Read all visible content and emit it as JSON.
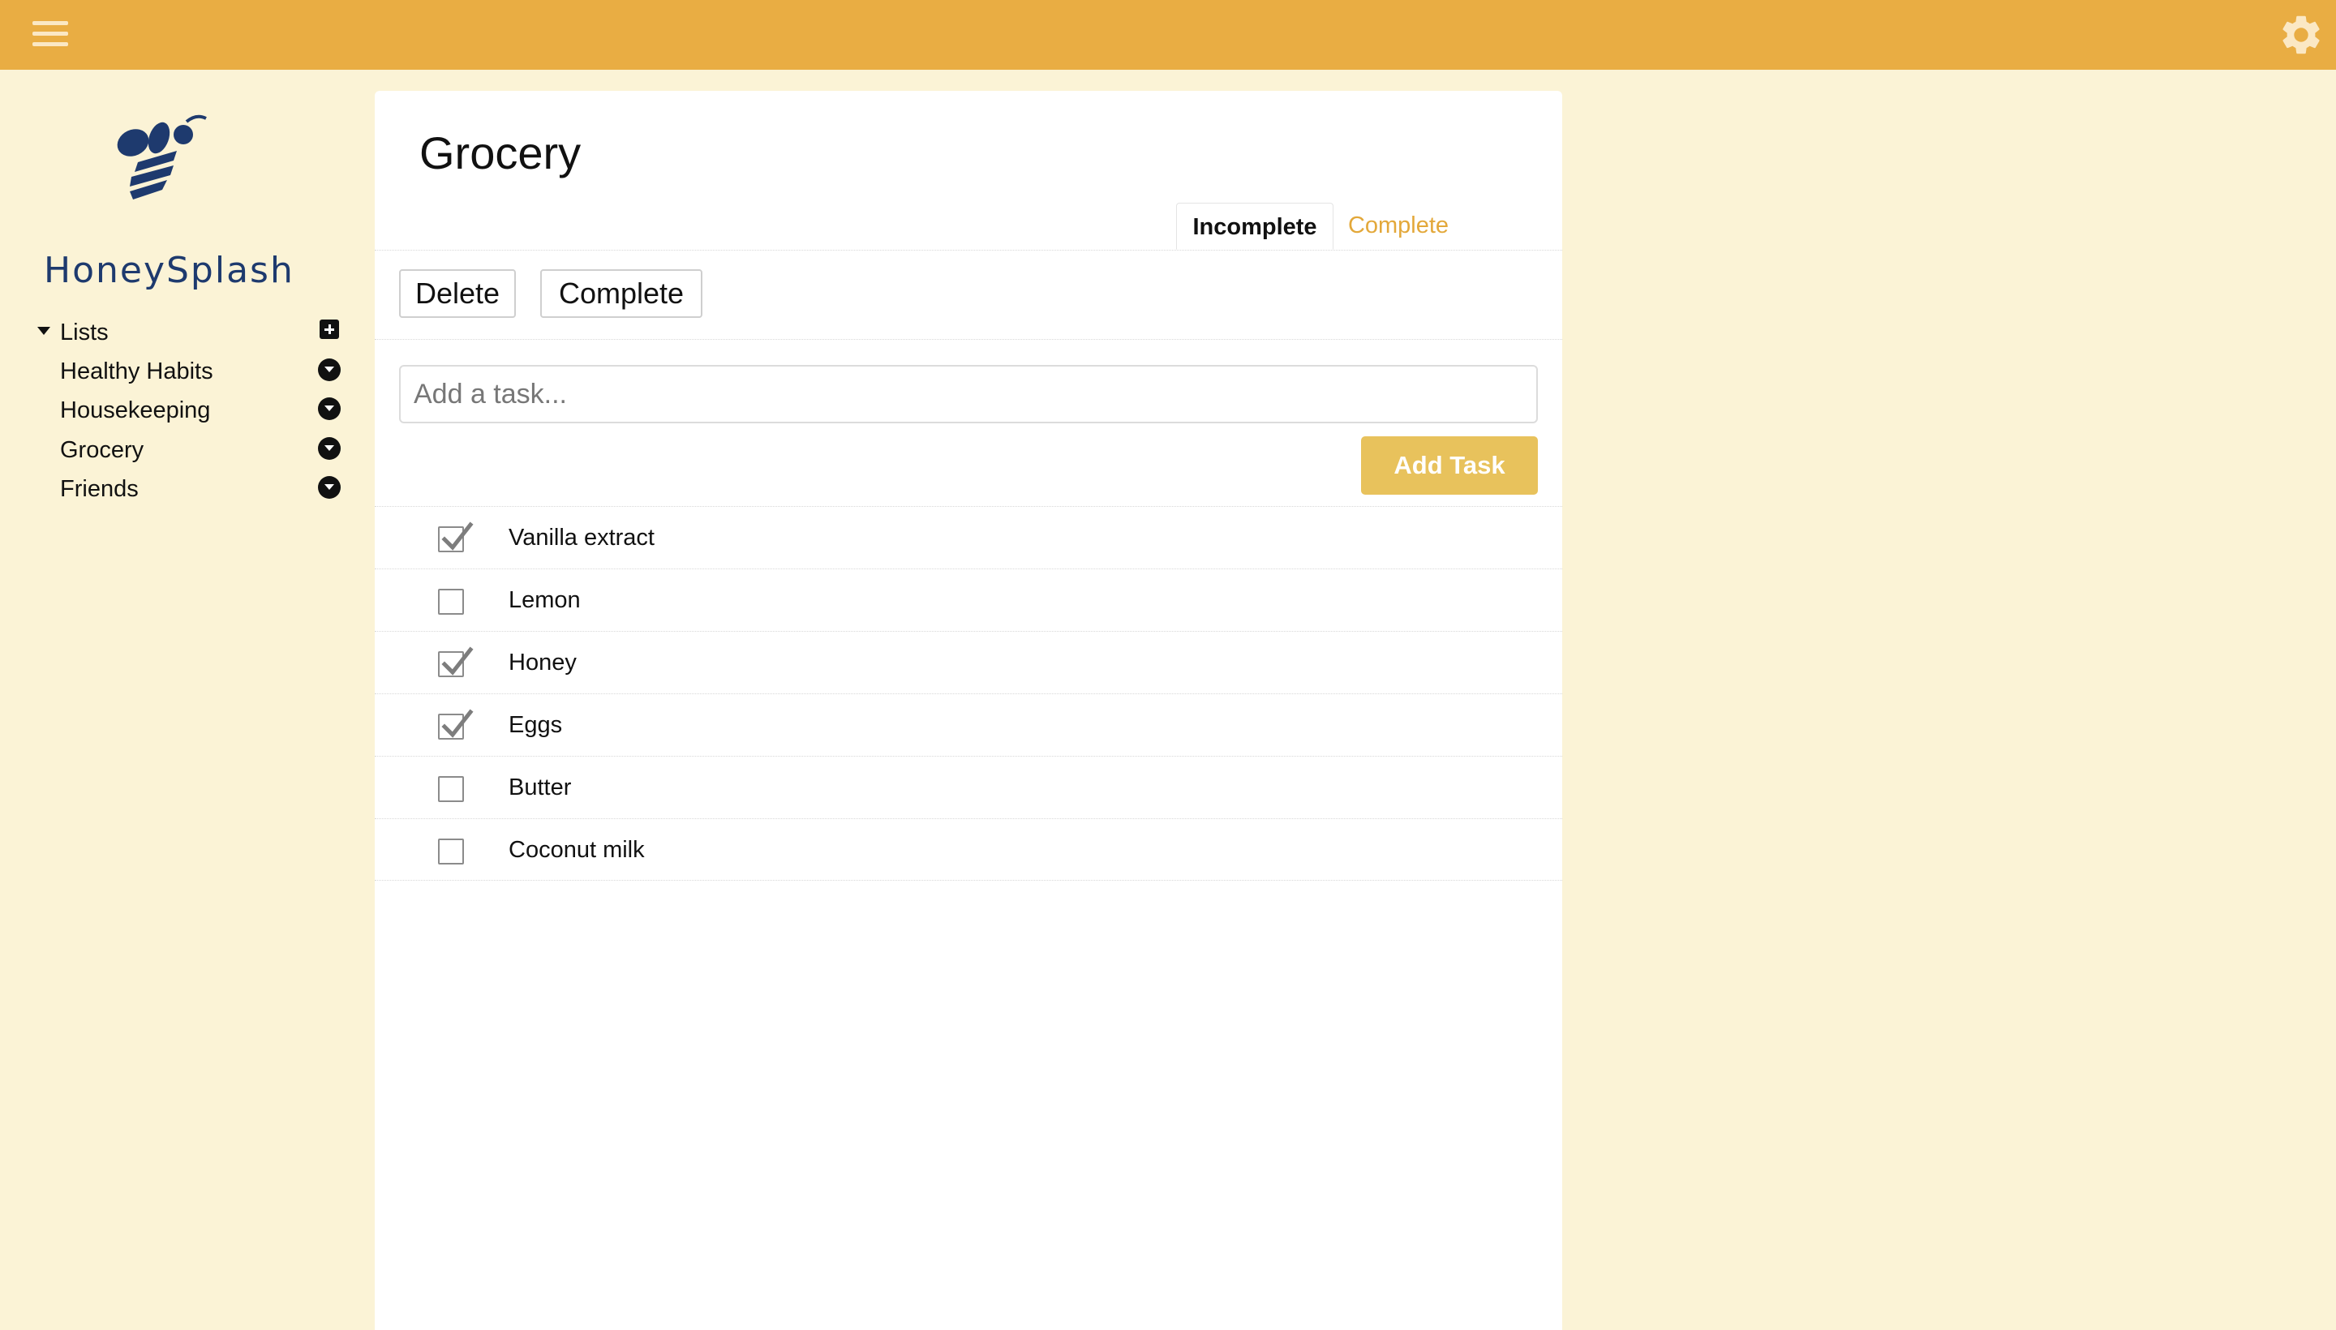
{
  "app": {
    "brand": "HoneySplash"
  },
  "colors": {
    "topbar": "#e9ad43",
    "background": "#fbf3d6",
    "accent": "#e3a83a",
    "add_button": "#e8c25c",
    "brand_text": "#1e3a6e"
  },
  "topbar": {
    "menu_icon": "hamburger-menu-icon",
    "settings_icon": "gear-icon"
  },
  "sidebar": {
    "section_label": "Lists",
    "add_icon": "plus-square-icon",
    "items": [
      {
        "label": "Healthy Habits",
        "menu_icon": "chevron-circle-down-icon"
      },
      {
        "label": "Housekeeping",
        "menu_icon": "chevron-circle-down-icon"
      },
      {
        "label": "Grocery",
        "menu_icon": "chevron-circle-down-icon"
      },
      {
        "label": "Friends",
        "menu_icon": "chevron-circle-down-icon"
      }
    ]
  },
  "main": {
    "title": "Grocery",
    "tabs": [
      {
        "label": "Incomplete",
        "active": true
      },
      {
        "label": "Complete",
        "active": false
      }
    ],
    "actions": {
      "delete_label": "Delete",
      "complete_label": "Complete"
    },
    "input": {
      "placeholder": "Add a task...",
      "value": ""
    },
    "add_button_label": "Add Task",
    "tasks": [
      {
        "label": "Vanilla extract",
        "checked": true
      },
      {
        "label": "Lemon",
        "checked": false
      },
      {
        "label": "Honey",
        "checked": true
      },
      {
        "label": "Eggs",
        "checked": true
      },
      {
        "label": "Butter",
        "checked": false
      },
      {
        "label": "Coconut milk",
        "checked": false
      }
    ]
  }
}
